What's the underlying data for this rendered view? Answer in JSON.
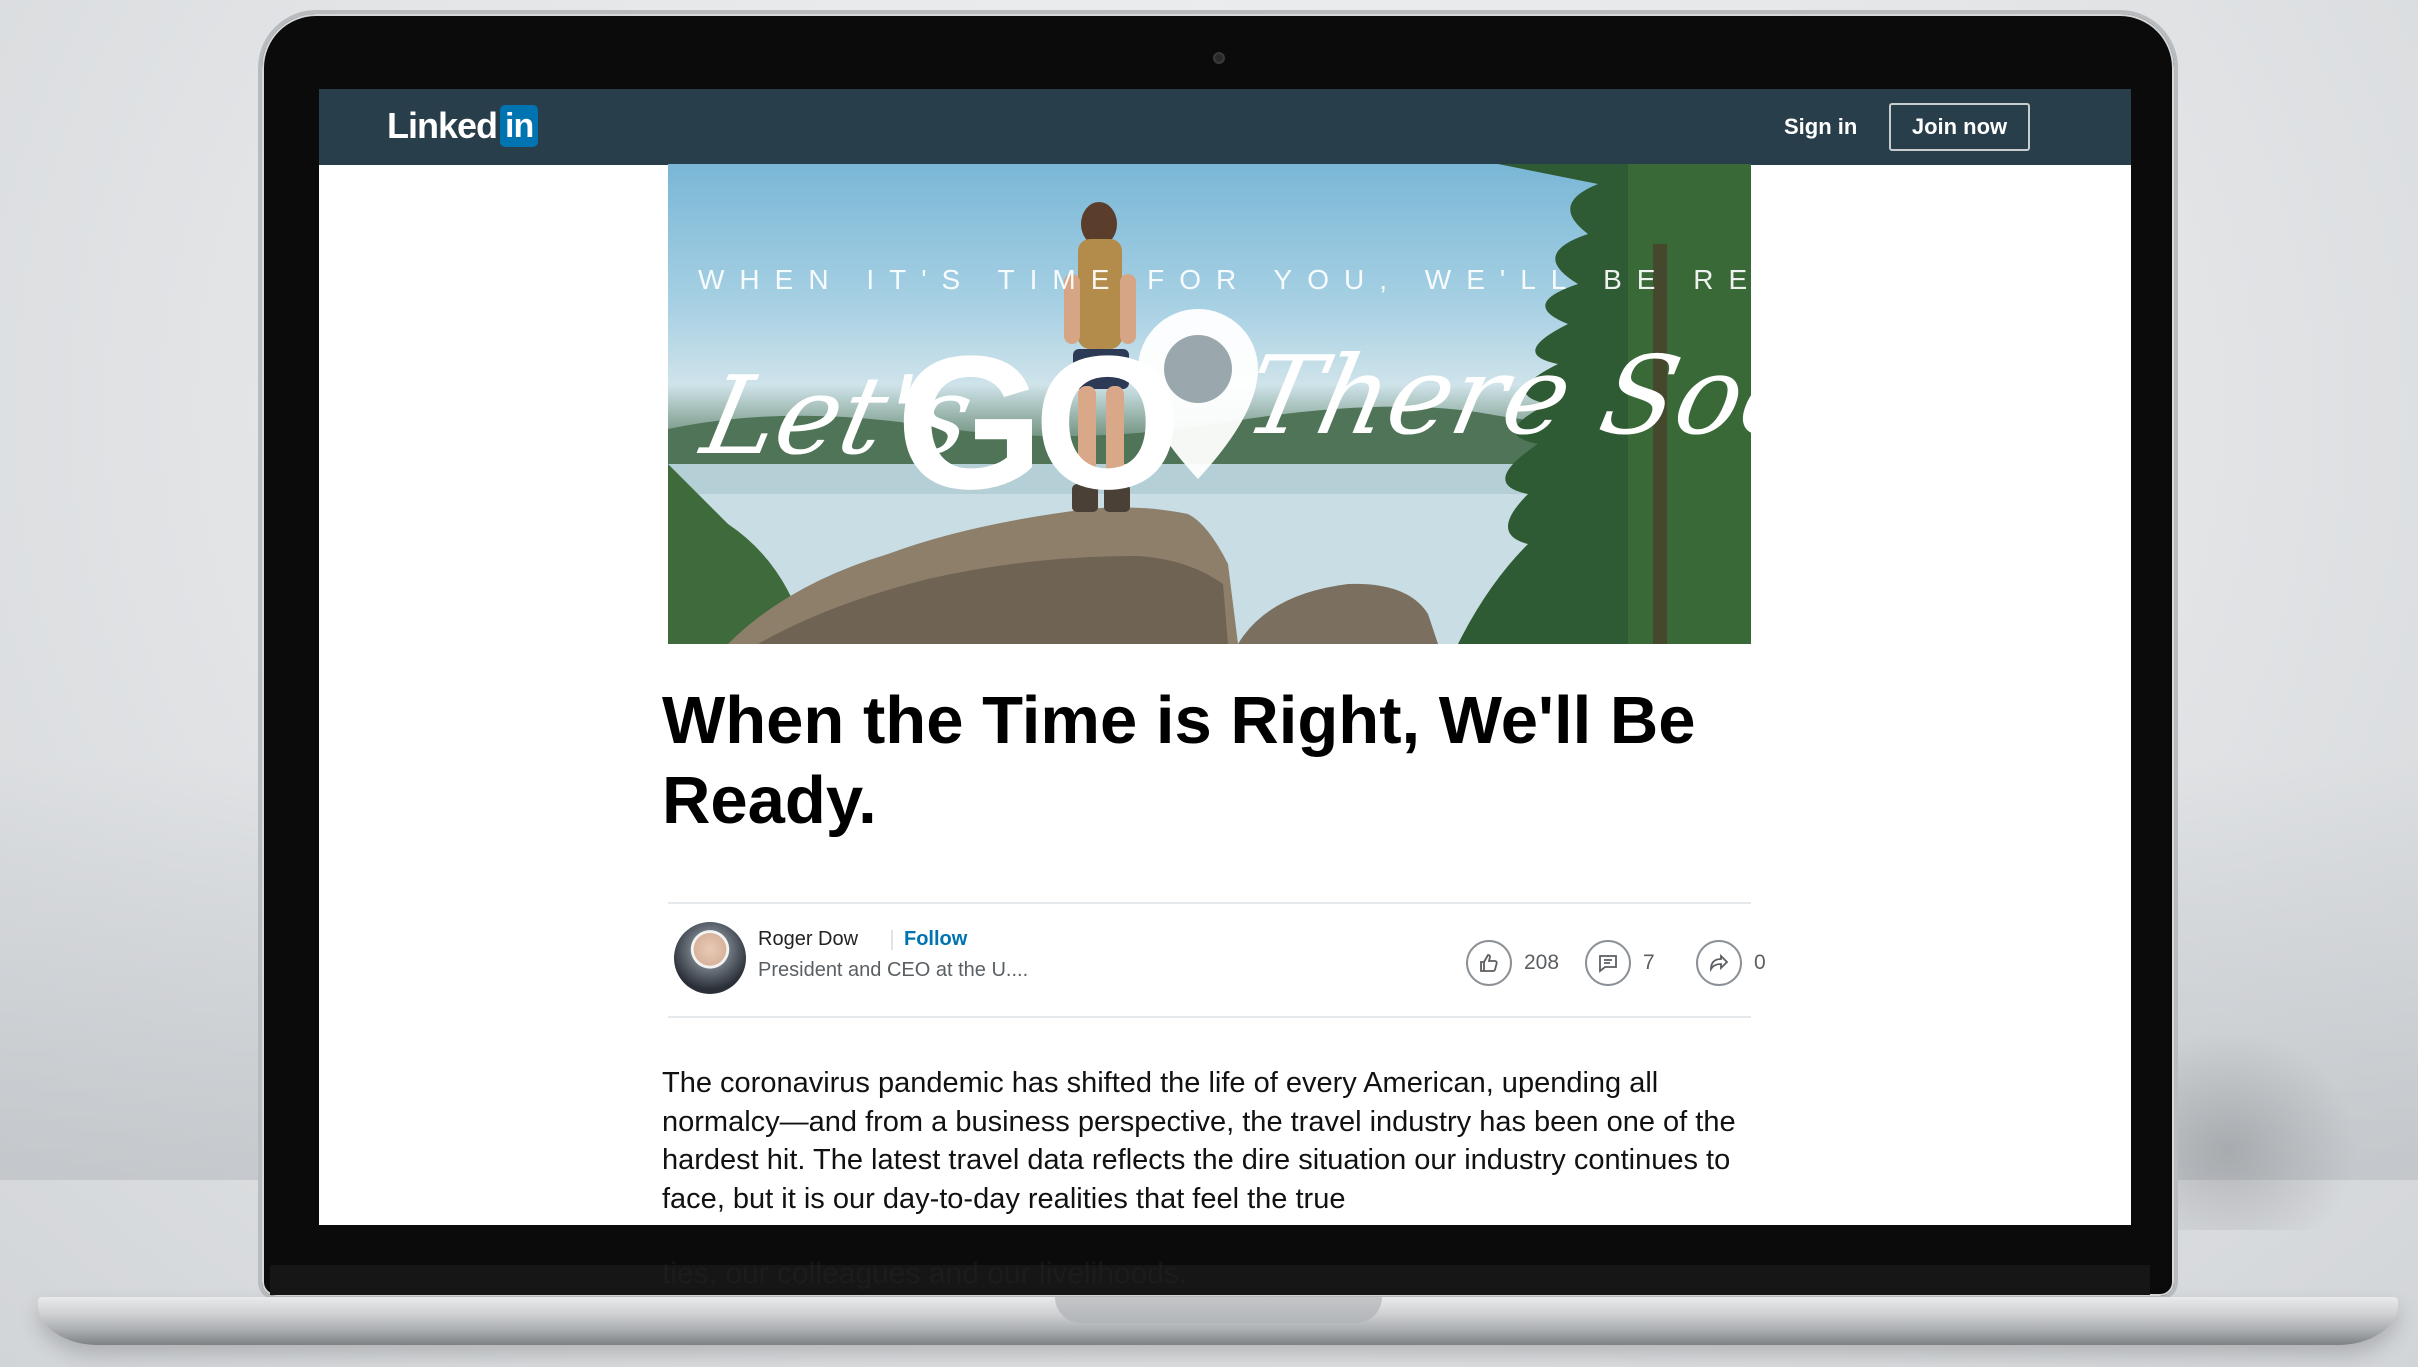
{
  "navbar": {
    "logo_text": "Linked",
    "logo_in": "in",
    "sign_in": "Sign in",
    "join_now": "Join now"
  },
  "hero": {
    "tagline": "WHEN IT'S TIME FOR YOU, WE'LL BE READY",
    "word_lets": "Let's",
    "word_go": "GO",
    "word_there_soon": "There Soon"
  },
  "article": {
    "title": "When the Time is Right, We'll Be Ready.",
    "author": {
      "name": "Roger Dow",
      "follow": "Follow",
      "headline": "President and CEO at the U...."
    },
    "stats": {
      "likes": "208",
      "comments": "7",
      "shares": "0"
    },
    "body": "The coronavirus pandemic has shifted the life of every American, upending all normalcy—and from a business perspective, the travel industry has been one of the hardest hit. The latest travel data reflects the dire situation our industry continues to face, but it is our day-to-day realities that feel the true",
    "body_overflow": "ties, our colleagues and our livelihoods."
  },
  "colors": {
    "navbar": "#283e4a",
    "brand_blue": "#0073b1"
  }
}
